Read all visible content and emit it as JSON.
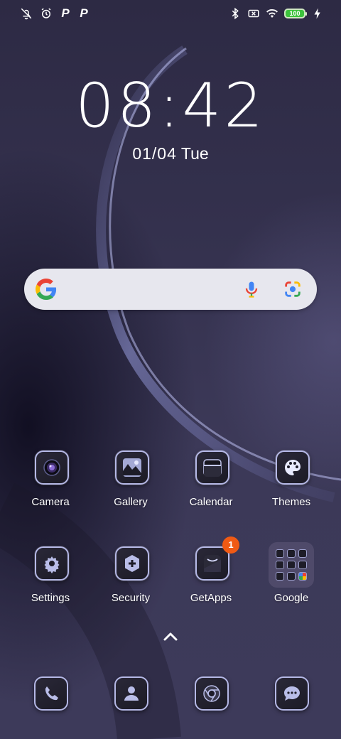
{
  "status_bar": {
    "left_icons": [
      "alarm-off-icon",
      "alarm-clock-icon",
      "p-icon",
      "p-icon"
    ],
    "p_letter": "P",
    "right_icons": [
      "bluetooth-icon",
      "no-sim-icon",
      "wifi-icon",
      "battery-icon",
      "charging-icon"
    ],
    "battery_level": "100",
    "battery_color": "#3cc33c"
  },
  "clock": {
    "time": "08:42",
    "date": "01/04",
    "weekday": "Tue"
  },
  "search_bar": {
    "icons": [
      "google-g-icon",
      "microphone-icon",
      "google-lens-icon"
    ]
  },
  "apps": [
    {
      "label": "Camera",
      "icon": "camera-icon"
    },
    {
      "label": "Gallery",
      "icon": "gallery-icon"
    },
    {
      "label": "Calendar",
      "icon": "calendar-icon"
    },
    {
      "label": "Themes",
      "icon": "palette-icon"
    },
    {
      "label": "Settings",
      "icon": "gear-icon"
    },
    {
      "label": "Security",
      "icon": "shield-plus-icon"
    },
    {
      "label": "GetApps",
      "icon": "getapps-icon",
      "badge": "1"
    },
    {
      "label": "Google",
      "icon": "folder-icon"
    }
  ],
  "drawer_handle_icon": "chevron-up-icon",
  "dock": [
    "phone-icon",
    "contacts-icon",
    "chrome-icon",
    "messages-icon"
  ]
}
